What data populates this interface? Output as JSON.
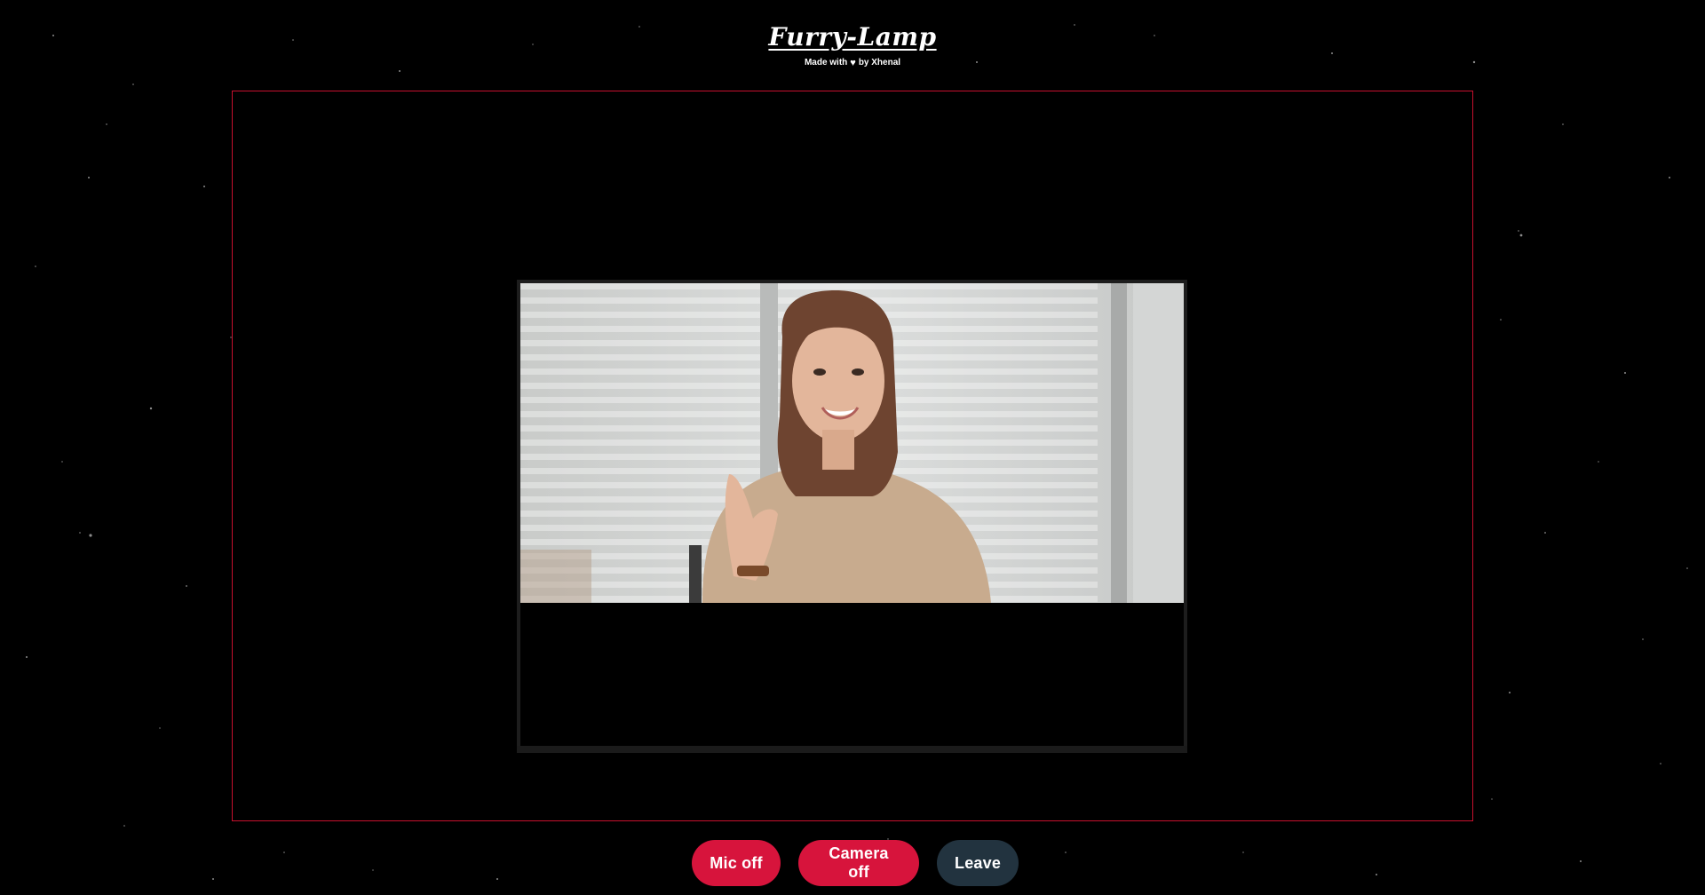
{
  "app": {
    "title": "Furry-Lamp",
    "tagline_prefix": "Made with",
    "tagline_suffix": "by Xhenal",
    "tagline_icon": "heart-icon"
  },
  "video": {
    "participant_feed_icon": "person-video-feed"
  },
  "controls": {
    "mic_label": "Mic off",
    "camera_label": "Camera off",
    "leave_label": "Leave"
  },
  "colors": {
    "accent_red": "#d7143c",
    "stage_border": "#c8102e",
    "leave_bg": "#22333f",
    "background": "#000000"
  }
}
